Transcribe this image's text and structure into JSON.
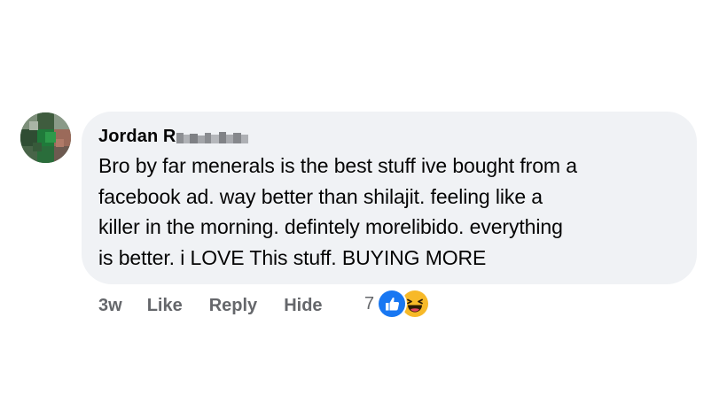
{
  "comment": {
    "author_name": "Jordan R",
    "author_name_obscured": "eynolds",
    "lines": [
      "Bro by far menerals is the best stuff ive bought from a",
      "facebook ad. way better than shilajit. feeling like a",
      "killer in the morning. defintely morelibido. everything",
      "is better. i LOVE This stuff. BUYING MORE"
    ]
  },
  "actions": {
    "time": "3w",
    "like_label": "Like",
    "reply_label": "Reply",
    "hide_label": "Hide"
  },
  "reactions": {
    "count": "7",
    "icons": [
      "like-icon",
      "haha-icon"
    ]
  },
  "colors": {
    "bubble": "#f0f2f5",
    "text": "#050505",
    "muted": "#65676b",
    "like_blue": "#1877f2",
    "haha_yellow": "#f7b928"
  }
}
